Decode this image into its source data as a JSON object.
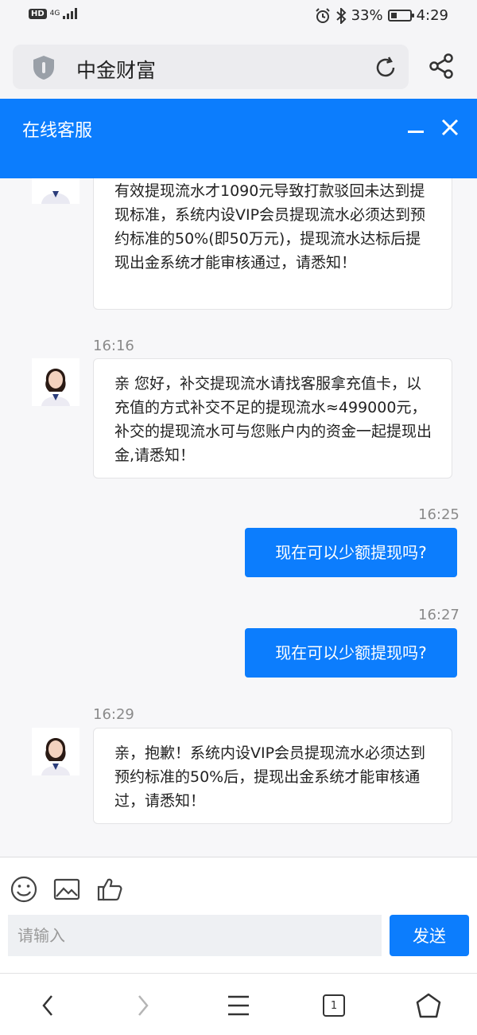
{
  "status_bar": {
    "left_badge": "HD",
    "network": "4G",
    "battery_text": "33%",
    "battery_level": 0.33,
    "time": "4:29"
  },
  "browser": {
    "address_title": "中金财富",
    "icons": [
      "shield-icon",
      "reload-icon",
      "share-icon"
    ]
  },
  "chat": {
    "title": "在线客服",
    "header_icons": [
      "minimize-icon",
      "close-icon"
    ],
    "messages": [
      {
        "direction": "in",
        "text": "有效提现流水才1090元导致打款驳回未达到提现标准，系统内设VIP会员提现流水必须达到预约标准的50%(即50万元)，提现流水达标后提现出金系统才能审核通过，请悉知！"
      },
      {
        "direction": "in",
        "time": "16:16",
        "text": "亲 您好，补交提现流水请找客服拿充值卡，以充值的方式补交不足的提现流水≈499000元，补交的提现流水可与您账户内的资金一起提现出金,请悉知！"
      },
      {
        "direction": "out",
        "time": "16:25",
        "text": "现在可以少额提现吗?"
      },
      {
        "direction": "out",
        "time": "16:27",
        "text": "现在可以少额提现吗?"
      },
      {
        "direction": "in",
        "time": "16:29",
        "text": "亲，抱歉！系统内设VIP会员提现流水必须达到预约标准的50%后，提现出金系统才能审核通过，请悉知！"
      }
    ]
  },
  "input": {
    "placeholder": "请输入",
    "send_label": "发送",
    "tool_icons": [
      "emoji-icon",
      "image-icon",
      "thumbs-up-icon"
    ]
  },
  "nav": {
    "tab_count": "1",
    "icons": [
      "back-icon",
      "forward-icon",
      "menu-icon",
      "tabs-icon",
      "home-icon"
    ]
  },
  "colors": {
    "accent": "#0c7dfd",
    "background": "#f7f7f9"
  }
}
